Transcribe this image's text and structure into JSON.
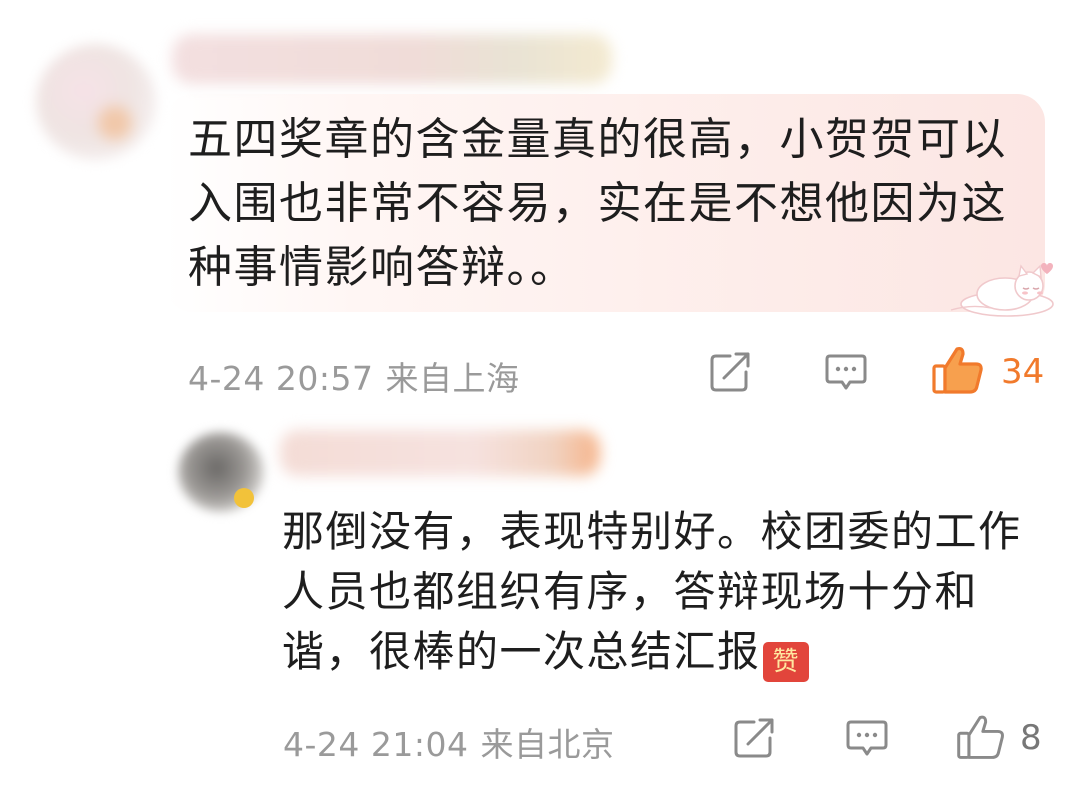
{
  "comments": [
    {
      "text": "五四奖章的含金量真的很高，小贺贺可以入围也非常不容易，实在是不想他因为这种事情影响答辩。。",
      "time": "4-24 20:57",
      "location": "来自上海",
      "likes": "34",
      "liked": true,
      "like_color": "#f17a2c"
    },
    {
      "text": "那倒没有，表现特别好。校团委的工作人员也都组织有序，答辩现场十分和谐，很棒的一次总结汇报",
      "emoji": "赞",
      "time": "4-24 21:04",
      "location": "来自北京",
      "likes": "8",
      "liked": false
    }
  ],
  "icons": {
    "share": "share-icon",
    "reply": "comment-icon",
    "like": "thumbs-up-icon"
  },
  "colors": {
    "meta_text": "#9a9a9a",
    "liked_accent": "#f17a2c",
    "bubble_bg": "#fdece9"
  }
}
